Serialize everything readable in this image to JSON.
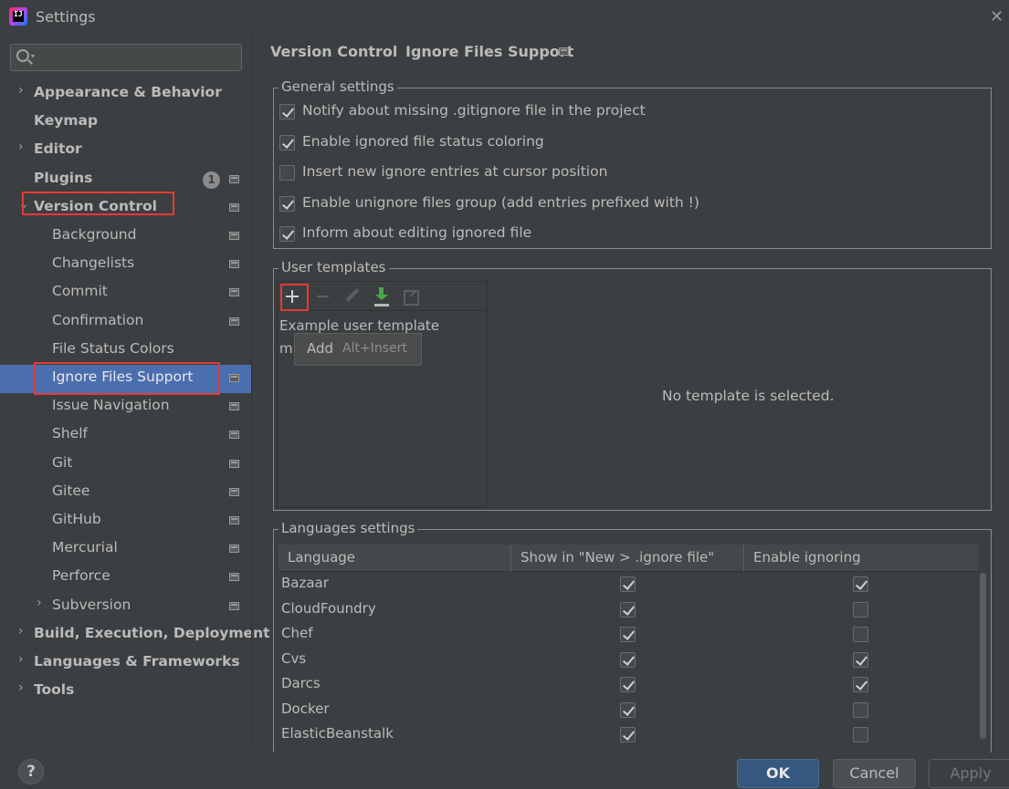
{
  "window": {
    "title": "Settings",
    "app_icon_text": "IJ"
  },
  "sidebar": {
    "search_placeholder": "",
    "items": [
      {
        "label": "Appearance & Behavior",
        "bold": true,
        "arrow": "›",
        "level": 0
      },
      {
        "label": "Keymap",
        "bold": true,
        "level": 0
      },
      {
        "label": "Editor",
        "bold": true,
        "arrow": "›",
        "level": 0
      },
      {
        "label": "Plugins",
        "bold": true,
        "level": 0,
        "badge": "1"
      },
      {
        "label": "Version Control",
        "bold": true,
        "arrow": "⌄",
        "level": 0
      },
      {
        "label": "Background",
        "level": 1
      },
      {
        "label": "Changelists",
        "level": 1
      },
      {
        "label": "Commit",
        "level": 1
      },
      {
        "label": "Confirmation",
        "level": 1
      },
      {
        "label": "File Status Colors",
        "level": 1
      },
      {
        "label": "Ignore Files Support",
        "level": 1,
        "selected": true
      },
      {
        "label": "Issue Navigation",
        "level": 1
      },
      {
        "label": "Shelf",
        "level": 1
      },
      {
        "label": "Git",
        "level": 1
      },
      {
        "label": "Gitee",
        "level": 1
      },
      {
        "label": "GitHub",
        "level": 1
      },
      {
        "label": "Mercurial",
        "level": 1
      },
      {
        "label": "Perforce",
        "level": 1
      },
      {
        "label": "Subversion",
        "level": 1,
        "arrow": "›"
      },
      {
        "label": "Build, Execution, Deployment",
        "bold": true,
        "arrow": "›",
        "level": 0
      },
      {
        "label": "Languages & Frameworks",
        "bold": true,
        "arrow": "›",
        "level": 0
      },
      {
        "label": "Tools",
        "bold": true,
        "arrow": "›",
        "level": 0
      }
    ]
  },
  "breadcrumb": {
    "parent": "Version Control",
    "separator": "›",
    "current": "Ignore Files Support"
  },
  "general": {
    "title": "General settings",
    "options": [
      {
        "label": "Notify about missing .gitignore file in the project",
        "checked": true
      },
      {
        "label": "Enable ignored file status coloring",
        "checked": true
      },
      {
        "label": "Insert new ignore entries at cursor position",
        "checked": false
      },
      {
        "label": "Enable unignore files group (add entries prefixed with !)",
        "checked": true
      },
      {
        "label": "Inform about editing ignored file",
        "checked": true
      }
    ]
  },
  "templates": {
    "title": "User templates",
    "items": [
      "Example user template",
      "m"
    ],
    "tooltip": {
      "label": "Add",
      "shortcut": "Alt+Insert"
    },
    "empty_message": "No template is selected."
  },
  "languages": {
    "title": "Languages settings",
    "columns": [
      "Language",
      "Show in \"New > .ignore file\"",
      "Enable ignoring"
    ],
    "rows": [
      {
        "name": "Bazaar",
        "show": true,
        "enable": true
      },
      {
        "name": "CloudFoundry",
        "show": true,
        "enable": false
      },
      {
        "name": "Chef",
        "show": true,
        "enable": false
      },
      {
        "name": "Cvs",
        "show": true,
        "enable": true
      },
      {
        "name": "Darcs",
        "show": true,
        "enable": true
      },
      {
        "name": "Docker",
        "show": true,
        "enable": false
      },
      {
        "name": "ElasticBeanstalk",
        "show": true,
        "enable": false
      }
    ]
  },
  "footer": {
    "help": "?",
    "ok": "OK",
    "cancel": "Cancel",
    "apply": "Apply"
  },
  "colors": {
    "selection": "#4b6eaf",
    "highlight_box": "#e53935",
    "ok_button": "#365880"
  }
}
